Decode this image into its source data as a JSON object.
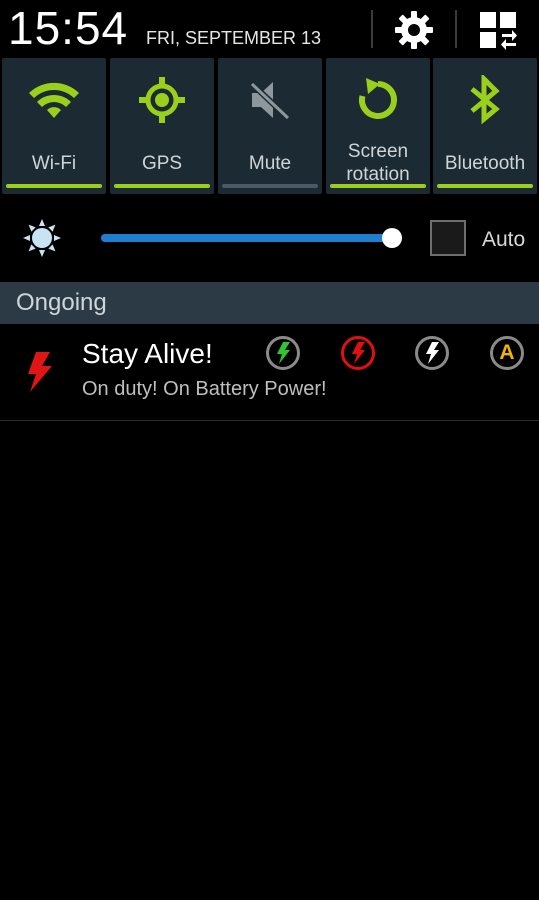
{
  "header": {
    "time": "15:54",
    "date": "FRI, SEPTEMBER 13",
    "settings_icon": "gear-icon",
    "multiwindow_icon": "grid-icon"
  },
  "quick_settings": [
    {
      "label": "Wi-Fi",
      "icon": "wifi-icon",
      "state": "on"
    },
    {
      "label": "GPS",
      "icon": "gps-icon",
      "state": "on"
    },
    {
      "label": "Mute",
      "icon": "mute-icon",
      "state": "off"
    },
    {
      "label": "Screen rotation",
      "label_line1": "Screen",
      "label_line2": "rotation",
      "icon": "rotation-icon",
      "state": "on"
    },
    {
      "label": "Bluetooth",
      "icon": "bluetooth-icon",
      "state": "on"
    }
  ],
  "brightness": {
    "level": 0.97,
    "auto_label": "Auto",
    "auto_checked": false
  },
  "ongoing": {
    "header": "Ongoing",
    "notification": {
      "title": "Stay Alive!",
      "text": "On duty! On Battery Power!",
      "actions": [
        {
          "icon": "bolt-green-icon",
          "color": "#31c531"
        },
        {
          "icon": "bolt-red-icon",
          "color": "#e01010"
        },
        {
          "icon": "bolt-white-icon",
          "color": "#ffffff"
        },
        {
          "icon": "auto-icon",
          "color": "#f0b400",
          "text": "A"
        }
      ]
    }
  },
  "colors": {
    "accent_on": "#9ad01c",
    "tile_bg": "#1b2a33",
    "slider": "#1e7fd0"
  }
}
